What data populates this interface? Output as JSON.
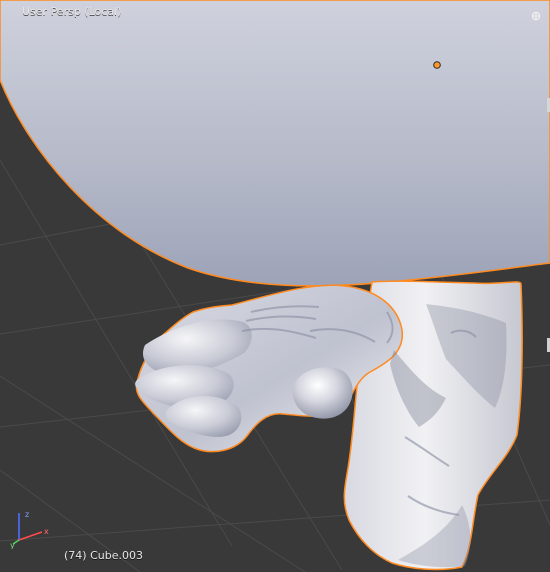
{
  "viewport": {
    "view_name": "User Persp (Local)",
    "object_info": "(74) Cube.003",
    "background_color": "#393939",
    "selection_outline_color": "#ff8a1f",
    "mesh_color": "#c8ccd8",
    "object_origin_color": "#ff9a2a"
  },
  "icons": {
    "view_options": "view-options-icon",
    "axis_gizmo": "axis-gizmo-icon"
  }
}
